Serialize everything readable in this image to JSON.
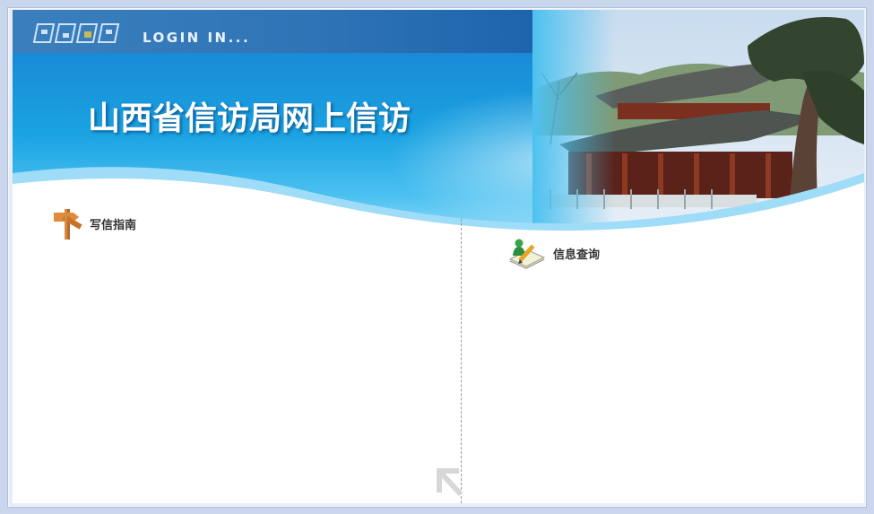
{
  "header": {
    "login_label": "LOGIN IN...",
    "logo_icon": "grid-logo-icon"
  },
  "banner": {
    "title": "山西省信访局网上信访",
    "photo": "temple-photo"
  },
  "sections": {
    "guide": {
      "label": "写信指南",
      "icon": "signpost-icon"
    },
    "query": {
      "label": "信息查询",
      "icon": "user-edit-icon"
    }
  },
  "colors": {
    "header_blue": "#1e65ad",
    "banner_cyan": "#1aa3e2",
    "wave_light": "#9fdcf7",
    "frame": "#c9d6ec"
  }
}
